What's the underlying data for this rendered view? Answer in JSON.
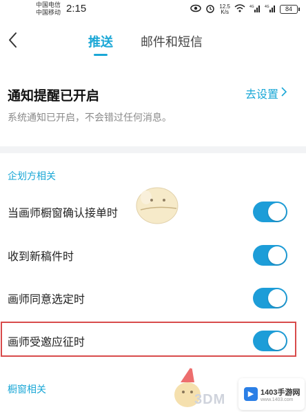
{
  "status_bar": {
    "carrier_1": "中国电信",
    "carrier_2": "中国移动",
    "time": "2:15",
    "net_speed_value": "12.5",
    "net_speed_unit": "K/s",
    "signal_1": "4G",
    "signal_2": "4G",
    "battery": "84"
  },
  "nav": {
    "tab_push": "推送",
    "tab_mail_sms": "邮件和短信",
    "active_tab": "推送"
  },
  "notification": {
    "title": "通知提醒已开启",
    "subtitle": "系统通知已开启，不会错过任何消息。",
    "settings_link": "去设置"
  },
  "sections": [
    {
      "header": "企划方相关",
      "items": [
        {
          "label": "当画师橱窗确认接单时",
          "enabled": true
        },
        {
          "label": "收到新稿件时",
          "enabled": true
        },
        {
          "label": "画师同意选定时",
          "enabled": true
        },
        {
          "label": "画师受邀应征时",
          "enabled": true
        }
      ]
    },
    {
      "header": "橱窗相关"
    }
  ],
  "watermark": {
    "text": "3DM",
    "site_name": "1403手游网",
    "site_url": "www.1403.com"
  },
  "colors": {
    "accent": "#1aa7d6",
    "toggle_on": "#1d9dd8",
    "highlight": "#d84a4a"
  }
}
